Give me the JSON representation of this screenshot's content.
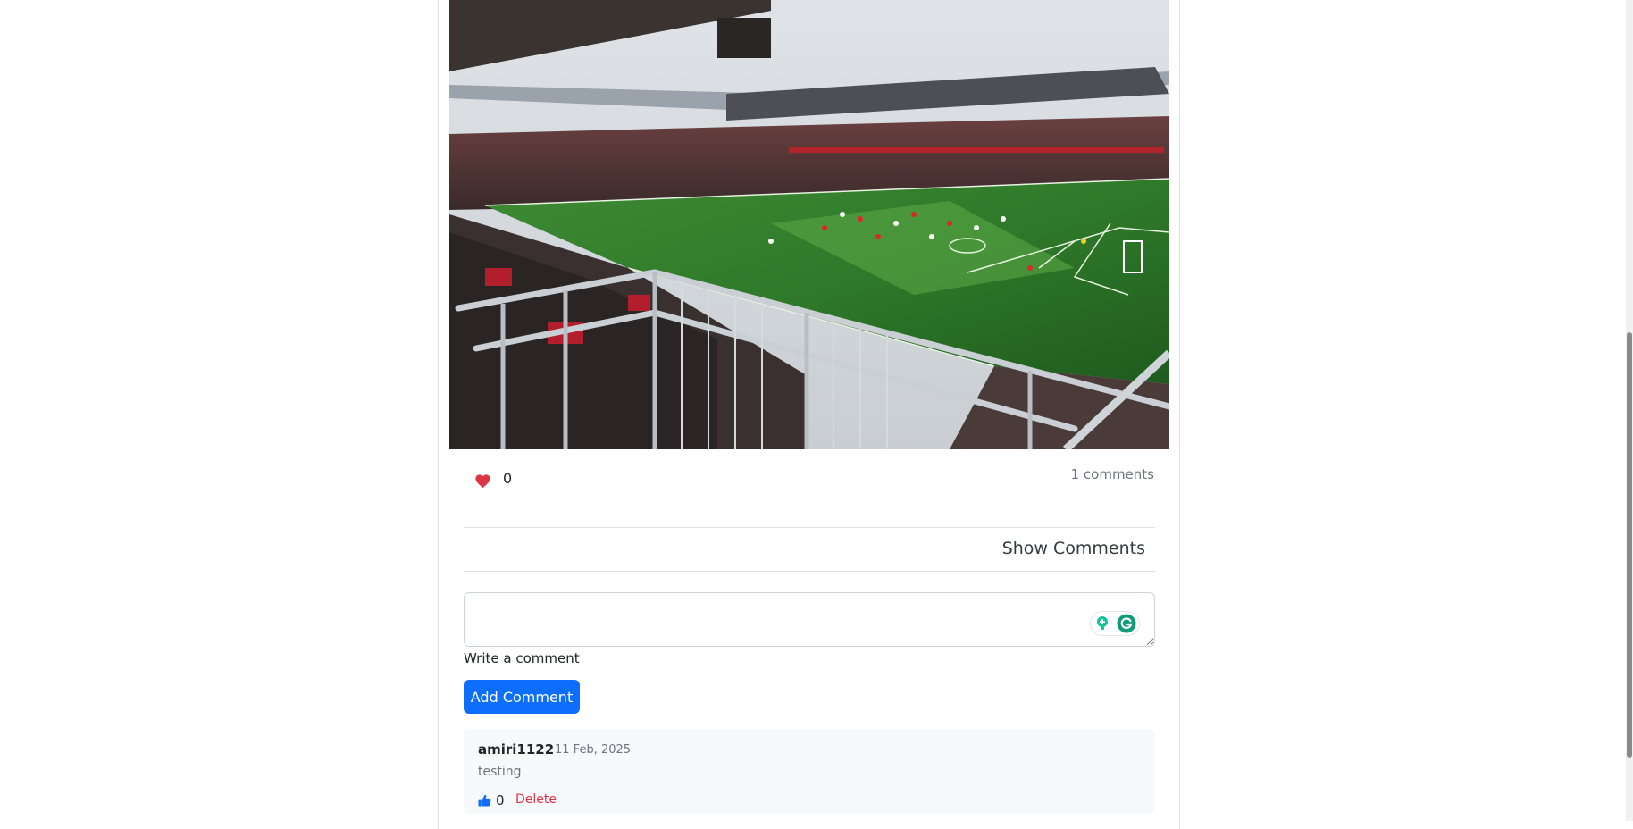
{
  "post": {
    "image_alt": "Stadium crowd watching football match",
    "likes": "0",
    "comments_count_label": "1 comments",
    "show_comments_label": "Show Comments"
  },
  "comment_form": {
    "label": "Write a comment",
    "value": "",
    "submit_label": "Add Comment"
  },
  "comments": [
    {
      "username": "amiri1122",
      "date": "11 Feb, 2025",
      "text": "testing",
      "likes": "0",
      "delete_label": "Delete"
    }
  ],
  "colors": {
    "like_heart": "#dc3545",
    "primary": "#0d6efd",
    "delete": "#dc3545",
    "grammarly": "#15c39a"
  },
  "icons": {
    "like": "heart-icon",
    "comment_like": "thumbs-up-icon",
    "grammarly": "grammarly-icon"
  }
}
